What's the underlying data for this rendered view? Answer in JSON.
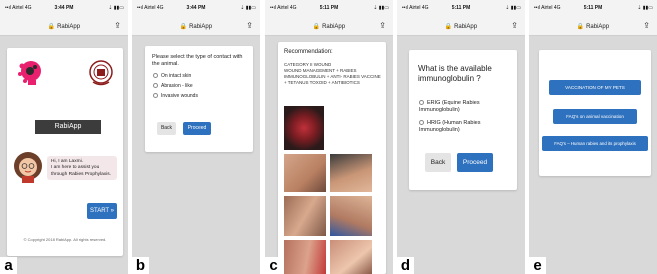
{
  "panels": [
    {
      "label": "a",
      "status": {
        "signal": "••ıl Airtel 4G",
        "time": "3:44 PM",
        "battery": "⇣ ▮▮▭"
      },
      "url": "RabiApp",
      "app_title": "RabiApp",
      "chat": "Hi, I am Laxmi.\nI am here to assist you through Rabies Prophylaxis.",
      "start_label": "START",
      "copyright": "© Copyright 2018 RabiApp. All rights reserved."
    },
    {
      "label": "b",
      "status": {
        "signal": "••ıl Airtel 4G",
        "time": "3:44 PM",
        "battery": "⇣ ▮▮▭"
      },
      "url": "RabiApp",
      "question": "Please select the type of contact with the animal.",
      "options": [
        "On intact skin",
        "Abrasion - like",
        "Invasive wounds"
      ],
      "back_label": "Back",
      "proceed_label": "Proceed"
    },
    {
      "label": "c",
      "status": {
        "signal": "••ıl Airtel 4G",
        "time": "5:11 PM",
        "battery": "⇣ ▮▮▭"
      },
      "url": "RabiApp",
      "heading": "Recommendation:",
      "text": "CATEGORY II WOUND\nWOUND MANAGEMENT + RABIES IMMUNOGLOBULIN + ANTI- RABIES VACCINE + TETANUS TOXOID + ANTIBIOTICS"
    },
    {
      "label": "d",
      "status": {
        "signal": "••ıl Airtel 4G",
        "time": "5:11 PM",
        "battery": "⇣ ▮▮▭"
      },
      "url": "RabiApp",
      "question": "What is the available immunoglobulin ?",
      "options": [
        "ERIG (Equine Rabies Immunoglobulin)",
        "HRIG (Human Rabies Immunoglobulin)"
      ],
      "back_label": "Back",
      "proceed_label": "Proceed"
    },
    {
      "label": "e",
      "status": {
        "signal": "••ıl Airtel 4G",
        "time": "5:11 PM",
        "battery": "⇣ ▮▮▭"
      },
      "url": "RabiApp",
      "menu": [
        "VACCINATION OF MY PETS",
        "FAQ's on animal vaccination",
        "FAQ's – Human rabies and its prophylaxis"
      ]
    }
  ],
  "colors": {
    "primary": "#2e71be",
    "background": "#d9d9d9",
    "logo_pink": "#e8206e",
    "logo_maroon": "#8c1b1b"
  }
}
